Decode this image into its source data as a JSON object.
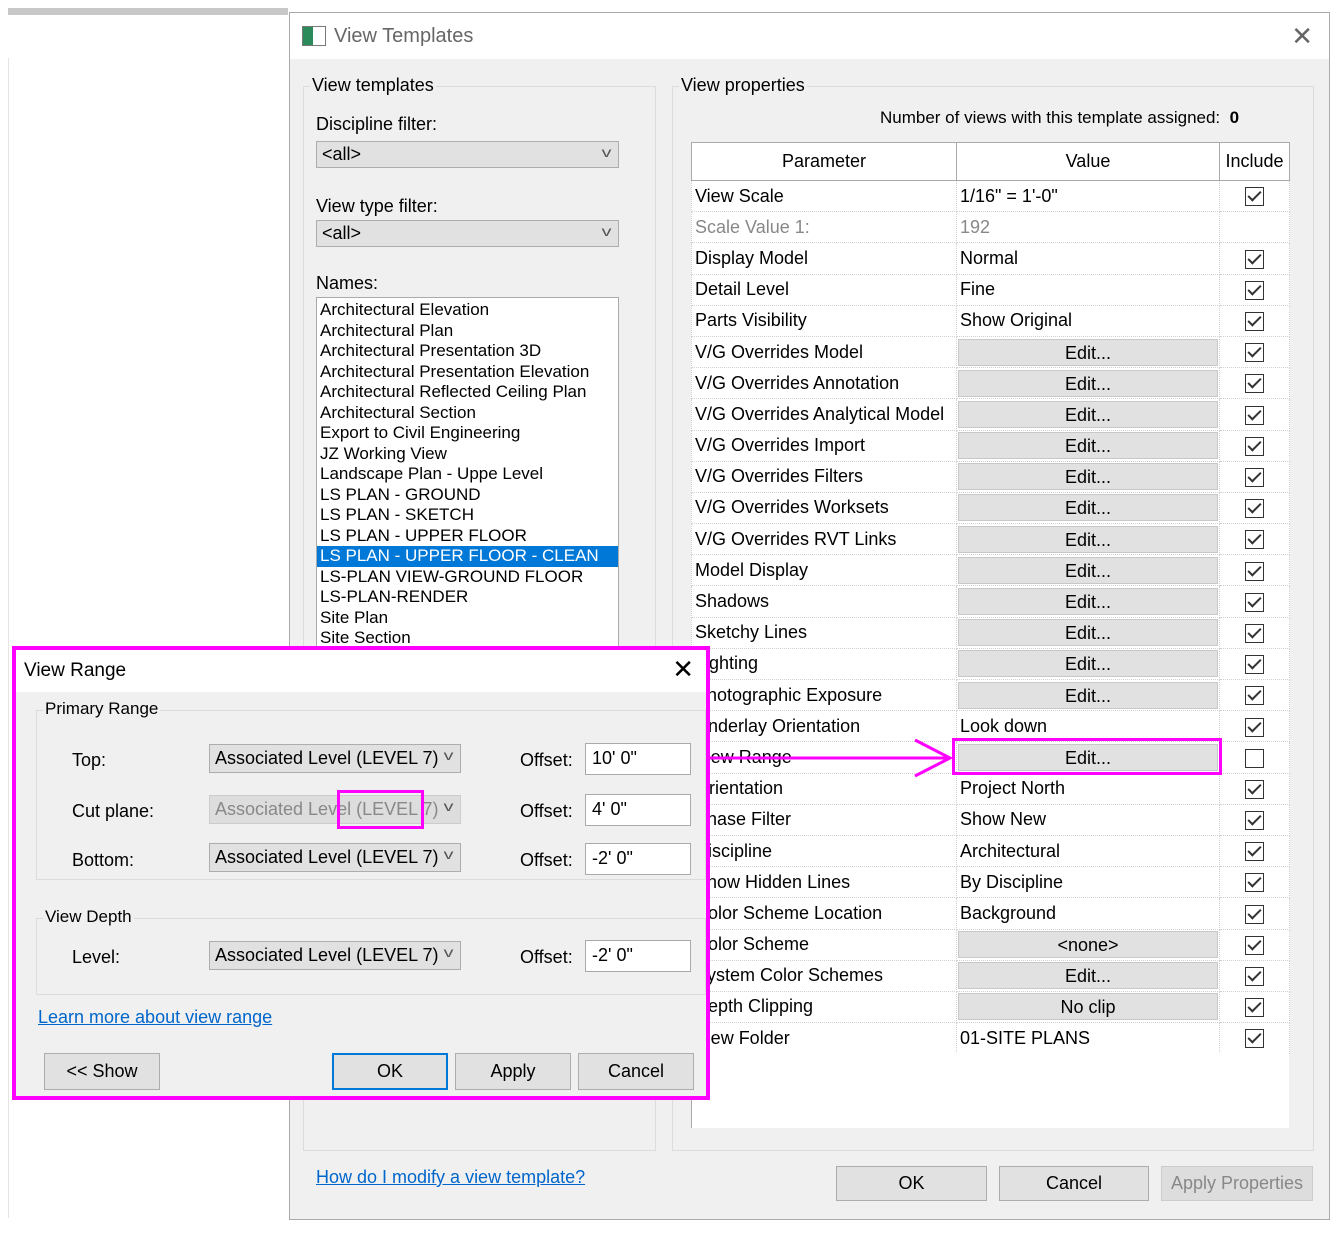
{
  "view_templates": {
    "title": "View Templates",
    "left_group": "View templates",
    "discipline_label": "Discipline filter:",
    "discipline_value": "<all>",
    "viewtype_label": "View type filter:",
    "viewtype_value": "<all>",
    "names_label": "Names:",
    "names": [
      "Architectural Elevation",
      "Architectural Plan",
      "Architectural Presentation 3D",
      "Architectural Presentation Elevation",
      "Architectural Reflected Ceiling Plan",
      "Architectural Section",
      "Export to Civil Engineering",
      "JZ Working View",
      "Landscape Plan - Uppe Level",
      "LS PLAN - GROUND",
      "LS PLAN - SKETCH",
      "LS PLAN - UPPER FLOOR",
      "LS PLAN - UPPER FLOOR - CLEAN",
      "LS-PLAN VIEW-GROUND FLOOR",
      "LS-PLAN-RENDER",
      "Site Plan",
      "Site Section"
    ],
    "selected_index": 12,
    "right_group": "View properties",
    "count_label": "Number of views with this template assigned:",
    "count_value": "0",
    "columns": [
      "Parameter",
      "Value",
      "Include"
    ],
    "rows": [
      {
        "p": "View Scale",
        "v": "1/16\" = 1'-0\"",
        "btn": false,
        "inc": true
      },
      {
        "p": "Scale Value    1:",
        "v": "192",
        "btn": false,
        "inc": null,
        "grey": true
      },
      {
        "p": "Display Model",
        "v": "Normal",
        "btn": false,
        "inc": true
      },
      {
        "p": "Detail Level",
        "v": "Fine",
        "btn": false,
        "inc": true
      },
      {
        "p": "Parts Visibility",
        "v": "Show Original",
        "btn": false,
        "inc": true
      },
      {
        "p": "V/G Overrides Model",
        "v": "Edit...",
        "btn": true,
        "inc": true
      },
      {
        "p": "V/G Overrides Annotation",
        "v": "Edit...",
        "btn": true,
        "inc": true
      },
      {
        "p": "V/G Overrides Analytical Model",
        "v": "Edit...",
        "btn": true,
        "inc": true
      },
      {
        "p": "V/G Overrides Import",
        "v": "Edit...",
        "btn": true,
        "inc": true
      },
      {
        "p": "V/G Overrides Filters",
        "v": "Edit...",
        "btn": true,
        "inc": true
      },
      {
        "p": "V/G Overrides Worksets",
        "v": "Edit...",
        "btn": true,
        "inc": true
      },
      {
        "p": "V/G Overrides RVT Links",
        "v": "Edit...",
        "btn": true,
        "inc": true
      },
      {
        "p": "Model Display",
        "v": "Edit...",
        "btn": true,
        "inc": true
      },
      {
        "p": "Shadows",
        "v": "Edit...",
        "btn": true,
        "inc": true
      },
      {
        "p": "Sketchy Lines",
        "v": "Edit...",
        "btn": true,
        "inc": true
      },
      {
        "p": "Lighting",
        "v": "Edit...",
        "btn": true,
        "inc": true
      },
      {
        "p": "Photographic Exposure",
        "v": "Edit...",
        "btn": true,
        "inc": true
      },
      {
        "p": "Underlay Orientation",
        "v": "Look down",
        "btn": false,
        "inc": true
      },
      {
        "p": "View Range",
        "v": "Edit...",
        "btn": true,
        "inc": false
      },
      {
        "p": "Orientation",
        "v": "Project North",
        "btn": false,
        "inc": true
      },
      {
        "p": "Phase Filter",
        "v": "Show New",
        "btn": false,
        "inc": true
      },
      {
        "p": "Discipline",
        "v": "Architectural",
        "btn": false,
        "inc": true
      },
      {
        "p": "Show Hidden Lines",
        "v": "By Discipline",
        "btn": false,
        "inc": true
      },
      {
        "p": "Color Scheme Location",
        "v": "Background",
        "btn": false,
        "inc": true
      },
      {
        "p": "Color Scheme",
        "v": "<none>",
        "btn": true,
        "inc": true
      },
      {
        "p": "System Color Schemes",
        "v": "Edit...",
        "btn": true,
        "inc": true
      },
      {
        "p": "Depth Clipping",
        "v": "No clip",
        "btn": true,
        "inc": true
      },
      {
        "p": "View Folder",
        "v": "01-SITE PLANS",
        "btn": false,
        "inc": true
      }
    ],
    "help_link": "How do I modify a view template?",
    "ok": "OK",
    "cancel": "Cancel",
    "apply": "Apply Properties"
  },
  "view_range": {
    "title": "View Range",
    "primary_group": "Primary Range",
    "top_label": "Top:",
    "top_level": "Associated Level (LEVEL 7)",
    "top_offset": "10'  0\"",
    "cut_label": "Cut plane:",
    "cut_level": "Associated Level (LEVEL 7)",
    "cut_offset": "4'  0\"",
    "bottom_label": "Bottom:",
    "bottom_level": "Associated Level (LEVEL 7)",
    "bottom_offset": "-2'  0\"",
    "depth_group": "View Depth",
    "level_label": "Level:",
    "depth_level": "Associated Level (LEVEL 7)",
    "depth_offset": "-2'  0\"",
    "offset_label": "Offset:",
    "learn_link": "Learn more about view range",
    "show": "<< Show",
    "ok": "OK",
    "apply": "Apply",
    "cancel": "Cancel"
  },
  "highlight_color": "#ff00ff"
}
